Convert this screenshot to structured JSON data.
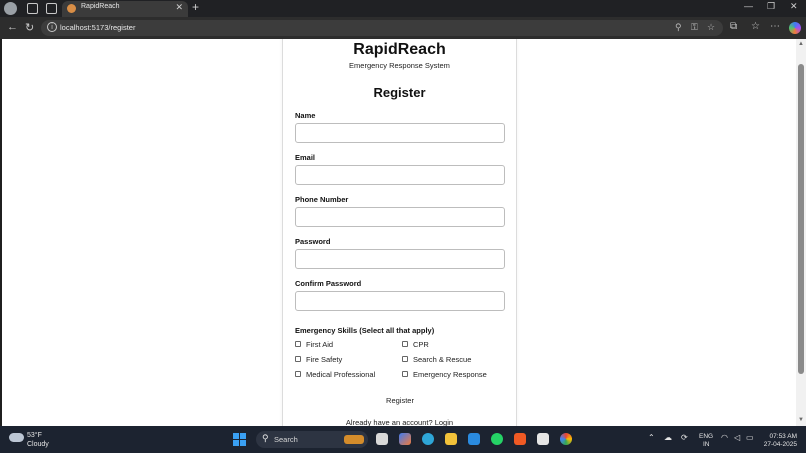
{
  "browser": {
    "tab_title": "RapidReach",
    "url": "localhost:5173/register"
  },
  "page": {
    "brand": "RapidReach",
    "tagline": "Emergency Response System",
    "heading": "Register",
    "fields": [
      {
        "label": "Name",
        "value": "",
        "placeholder": ""
      },
      {
        "label": "Email",
        "value": "",
        "placeholder": ""
      },
      {
        "label": "Phone Number",
        "value": "",
        "placeholder": ""
      },
      {
        "label": "Password",
        "value": "",
        "placeholder": ""
      },
      {
        "label": "Confirm Password",
        "value": "",
        "placeholder": ""
      }
    ],
    "skills_label": "Emergency Skills (Select all that apply)",
    "skills": [
      {
        "label": "First Aid",
        "checked": false
      },
      {
        "label": "CPR",
        "checked": false
      },
      {
        "label": "Fire Safety",
        "checked": false
      },
      {
        "label": "Search & Rescue",
        "checked": false
      },
      {
        "label": "Medical Professional",
        "checked": false
      },
      {
        "label": "Emergency Response",
        "checked": false
      }
    ],
    "submit_label": "Register",
    "login_prompt": "Already have an account? Login"
  },
  "taskbar": {
    "temperature": "53°F",
    "weather": "Cloudy",
    "search_label": "Search",
    "lang_line1": "ENG",
    "lang_line2": "IN",
    "time": "07:53 AM",
    "date": "27-04-2025"
  },
  "colors": {
    "windows_accent": "#3aa0f3",
    "taskbar_bg": "#1c2330",
    "browser_chrome": "#202124"
  }
}
